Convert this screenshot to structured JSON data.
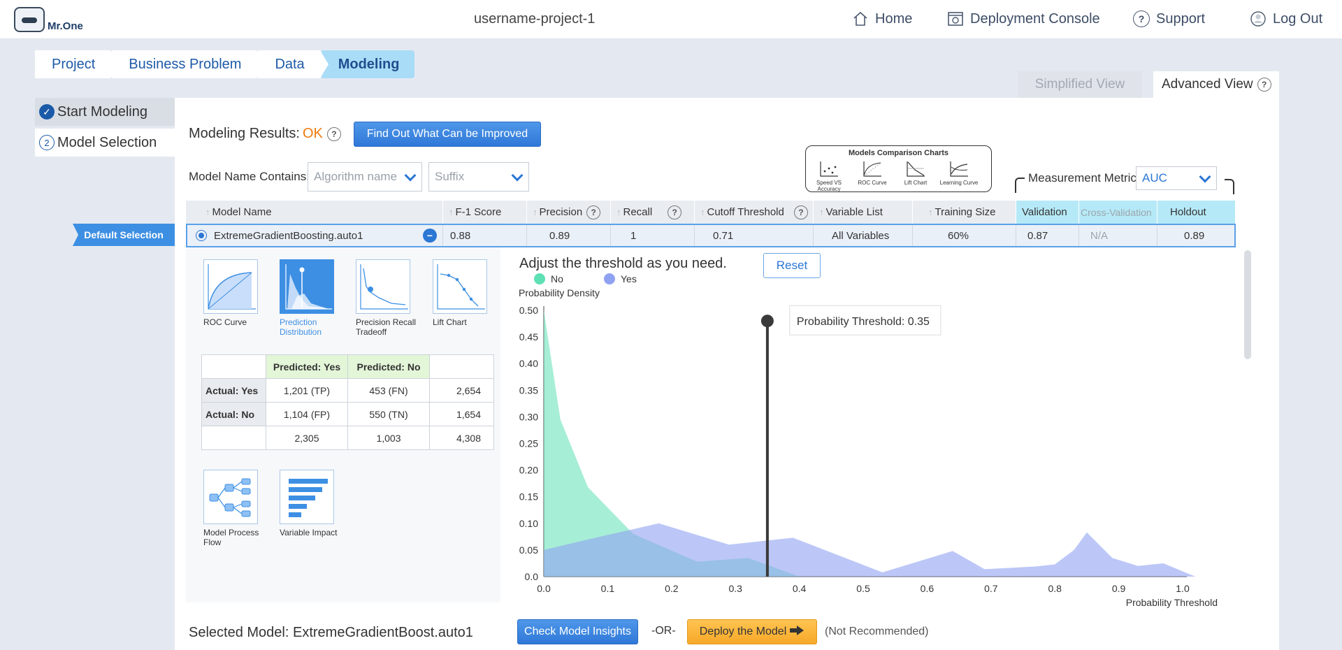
{
  "header": {
    "logo_text": "Mr.One",
    "project_name": "username-project-1",
    "nav": {
      "home": "Home",
      "deployment_console": "Deployment Console",
      "support": "Support",
      "logout": "Log Out",
      "support_icon_glyph": "?"
    }
  },
  "breadcrumb": [
    "Project",
    "Business Problem",
    "Data",
    "Modeling"
  ],
  "view_tabs": {
    "simplified": "Simplified View",
    "advanced": "Advanced View"
  },
  "steps": [
    {
      "label": "Start Modeling",
      "marker": "✓"
    },
    {
      "label": "Model Selection",
      "marker": "2"
    }
  ],
  "results": {
    "label": "Modeling Results:",
    "status": "OK",
    "status_color": "#ee7a10",
    "improve_button": "Find Out What Can be Improved"
  },
  "filters": {
    "name_contains": "Model Name Contains:",
    "algorithm_placeholder": "Algorithm name",
    "suffix_placeholder": "Suffix"
  },
  "comparison_charts": {
    "title": "Models Comparison Charts",
    "items": [
      "Speed VS Accuracy",
      "ROC Curve",
      "Lift Chart",
      "Learning Curve"
    ]
  },
  "metric": {
    "label": "Measurement Metric:",
    "value": "AUC"
  },
  "table": {
    "columns": [
      "Model Name",
      "F-1 Score",
      "Precision",
      "Recall",
      "Cutoff Threshold",
      "Variable List",
      "Training Size",
      "Validation",
      "Cross-Validation",
      "Holdout"
    ],
    "default_selection": "Default Selection",
    "row": {
      "model_name": "ExtremeGradientBoosting.auto1",
      "f1": "0.88",
      "precision": "0.89",
      "recall": "1",
      "cutoff": "0.71",
      "variable_list": "All Variables",
      "training_size": "60%",
      "validation": "0.87",
      "cross_validation": "N/A",
      "holdout": "0.89"
    }
  },
  "thumbnails": [
    "ROC Curve",
    "Prediction Distribution",
    "Precision Recall Tradeoff",
    "Lift Chart",
    "Model Process Flow",
    "Variable Impact"
  ],
  "confusion_matrix": {
    "col_headers": [
      "Predicted: Yes",
      "Predicted: No"
    ],
    "rows": [
      {
        "label": "Actual: Yes",
        "values": [
          "1,201 (TP)",
          "453 (FN)",
          "2,654"
        ]
      },
      {
        "label": "Actual: No",
        "values": [
          "1,104 (FP)",
          "550 (TN)",
          "1,654"
        ]
      },
      {
        "label": "",
        "values": [
          "2,305",
          "1,003",
          "4,308"
        ]
      }
    ]
  },
  "chart_header": {
    "adjust_text": "Adjust the threshold as you need.",
    "reset_button": "Reset"
  },
  "chart_data": {
    "type": "area",
    "xlabel": "Probability Threshold",
    "ylabel": "Probability Density",
    "xlim": [
      0,
      1
    ],
    "ylim": [
      0,
      0.5
    ],
    "x_ticks": [
      "0.0",
      "0.1",
      "0.2",
      "0.3",
      "0.4",
      "0.5",
      "0.6",
      "0.7",
      "0.8",
      "0.9",
      "1.0"
    ],
    "y_ticks": [
      "0.0",
      "0.05",
      "0.10",
      "0.15",
      "0.20",
      "0.25",
      "0.30",
      "0.35",
      "0.40",
      "0.45",
      "0.50"
    ],
    "legend": "top-left",
    "threshold": 0.35,
    "threshold_label": "Probability Threshold: 0.35",
    "series": [
      {
        "name": "No",
        "color": "#5ee0b5",
        "x": [
          0,
          0.026,
          0.069,
          0.14,
          0.24,
          0.32,
          0.4
        ],
        "y": [
          0.5,
          0.295,
          0.168,
          0.08,
          0.028,
          0.035,
          0
        ]
      },
      {
        "name": "Yes",
        "color": "#8fa2f2",
        "x": [
          0,
          0.07,
          0.18,
          0.29,
          0.39,
          0.53,
          0.64,
          0.69,
          0.77,
          0.8,
          0.83,
          0.85,
          0.89,
          0.93,
          0.97,
          1.02
        ],
        "y": [
          0.05,
          0.07,
          0.1,
          0.06,
          0.073,
          0.008,
          0.048,
          0.014,
          0.019,
          0.023,
          0.05,
          0.083,
          0.035,
          0.02,
          0.025,
          0
        ]
      }
    ]
  },
  "footer": {
    "selected_model": "Selected Model: ExtremeGradientBoost.auto1",
    "check_insights": "Check Model Insights",
    "or": "-OR-",
    "deploy": "Deploy the Model",
    "not_recommended": "(Not Recommended)"
  }
}
